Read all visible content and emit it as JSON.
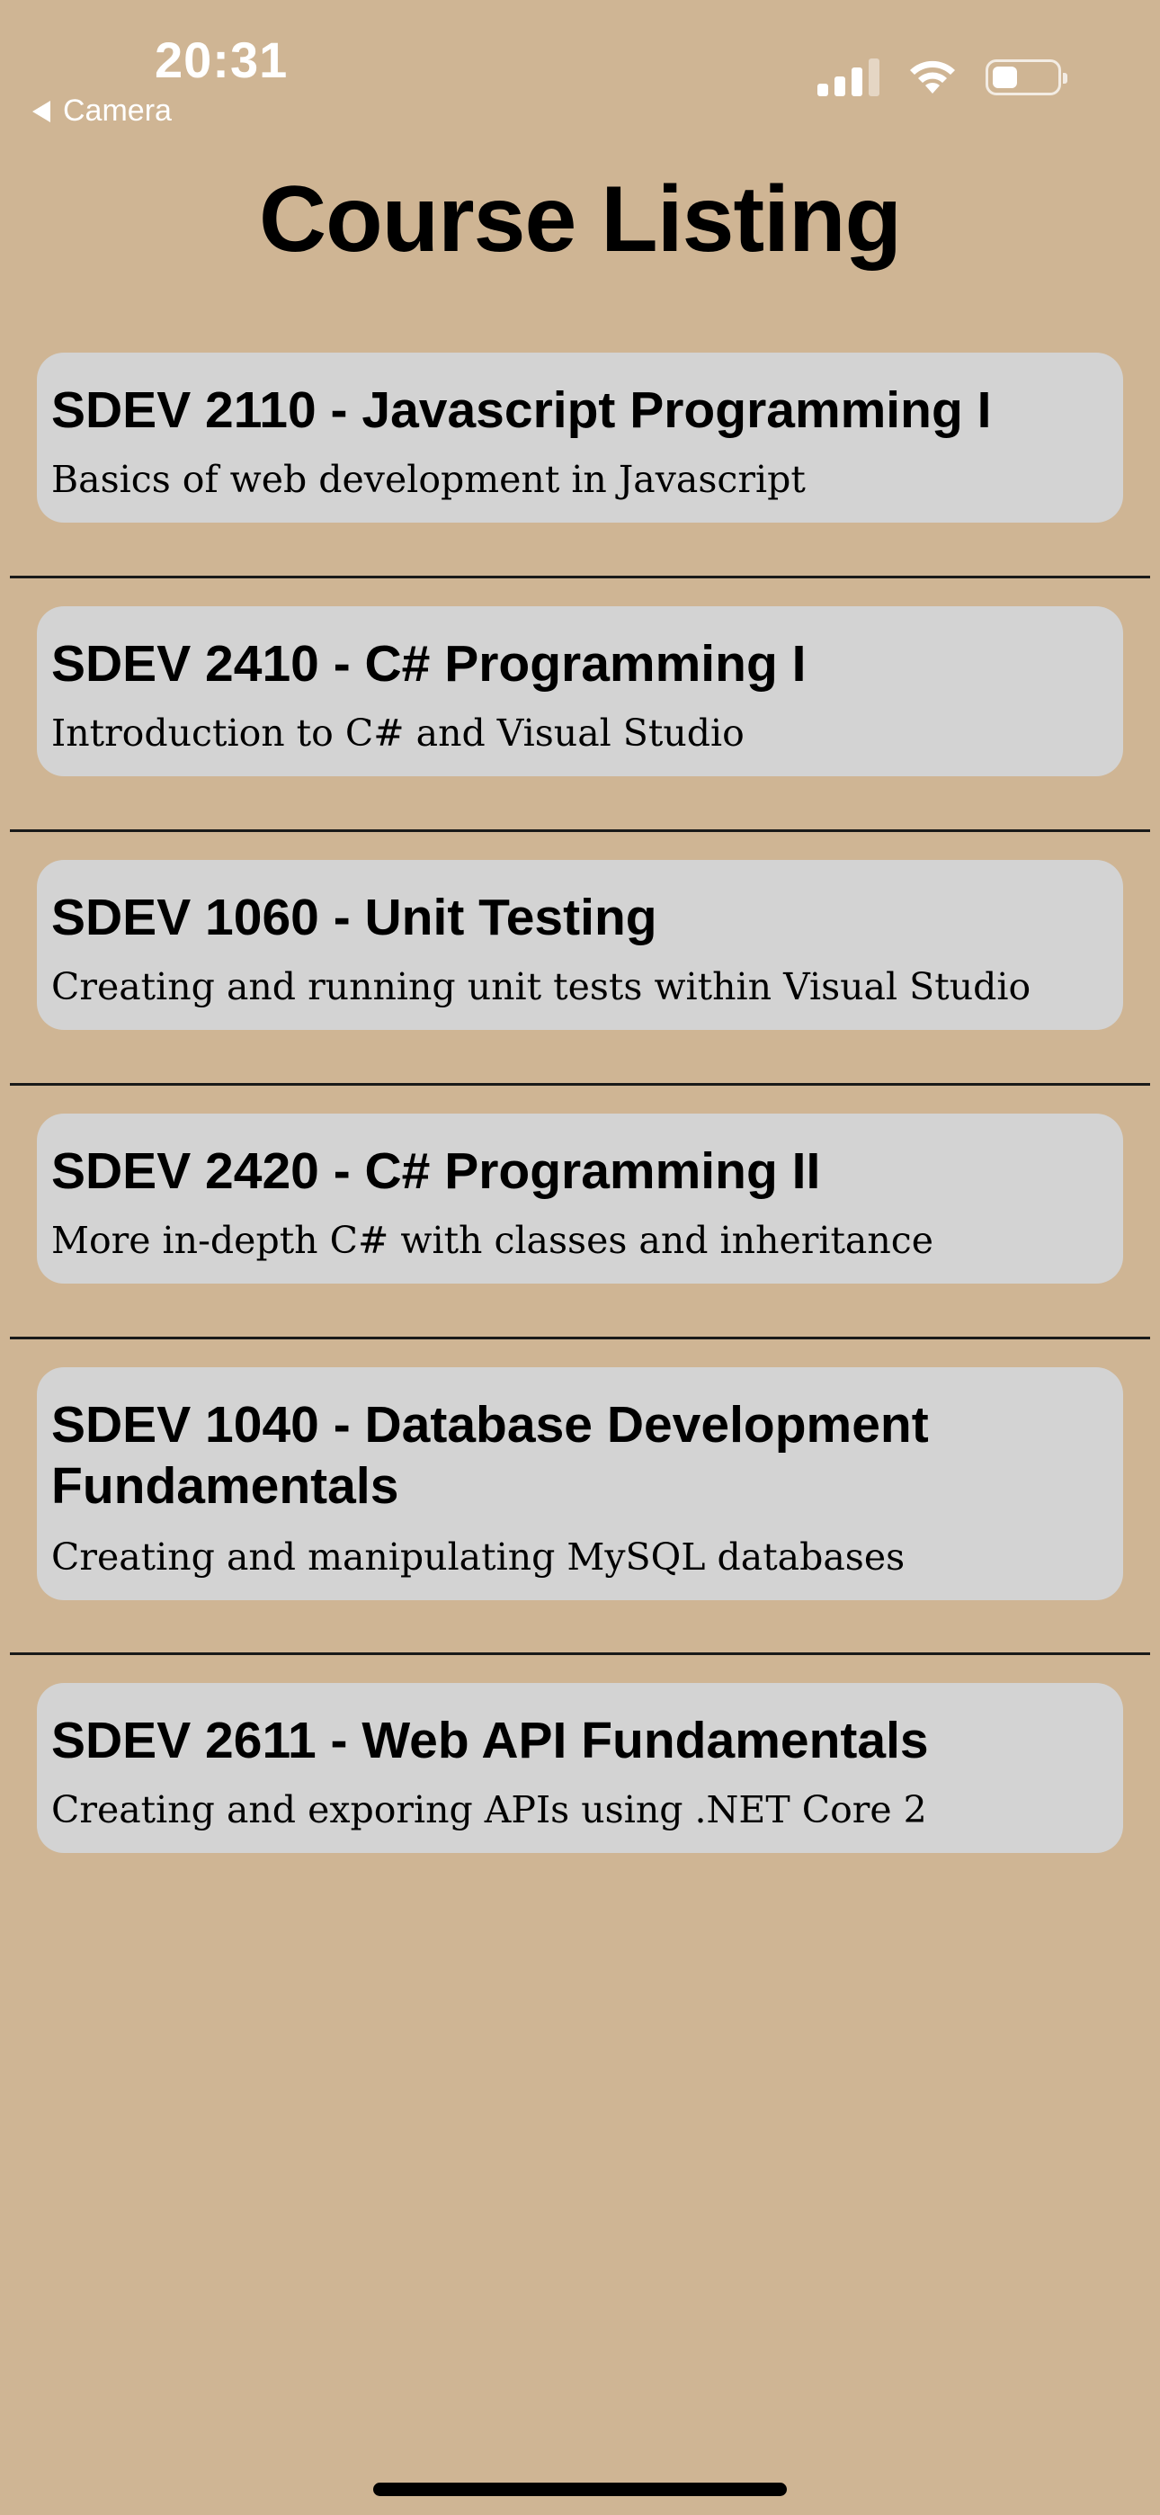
{
  "status_bar": {
    "time": "20:31",
    "back_label": "Camera",
    "battery_level_percent": 40
  },
  "page": {
    "title": "Course Listing"
  },
  "courses": [
    {
      "title": "SDEV 2110 - Javascript Programming I",
      "description": "Basics of web development in Javascript"
    },
    {
      "title": "SDEV 2410 - C# Programming I",
      "description": "Introduction to C# and Visual Studio"
    },
    {
      "title": "SDEV 1060 - Unit Testing",
      "description": "Creating and running unit tests within Visual Studio"
    },
    {
      "title": "SDEV 2420 - C# Programming II",
      "description": "More in-depth C# with classes and inheritance"
    },
    {
      "title": "SDEV 1040 - Database Development Fundamentals",
      "description": "Creating and manipulating MySQL databases"
    },
    {
      "title": "SDEV 2611 - Web API Fundamentals",
      "description": "Creating and exporing APIs using .NET Core 2"
    }
  ]
}
